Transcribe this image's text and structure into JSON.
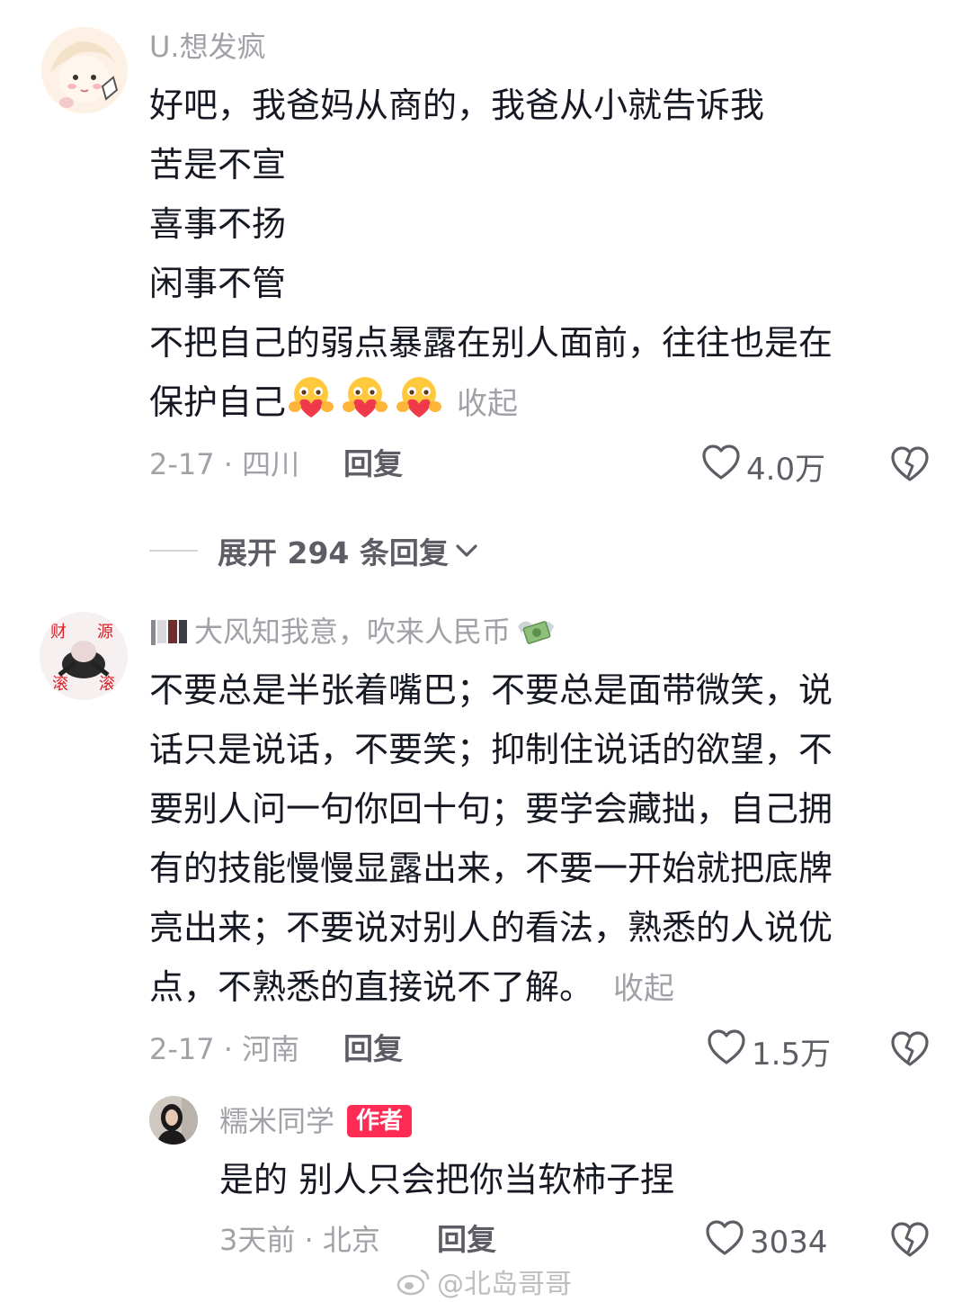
{
  "comments": [
    {
      "username": "U.想发疯",
      "lines": [
        "好吧，我爸妈从商的，我爸从小就告诉我",
        "苦是不宣",
        "喜事不扬",
        "闲事不管",
        "不把自己的弱点暴露在别人面前，往往也是在",
        "保护自己"
      ],
      "emoji": "heart-hug-emoji",
      "collapse": "收起",
      "date_location": "2-17 · 四川",
      "reply": "回复",
      "likes": "4.0万",
      "expand_replies": "展开 294 条回复"
    },
    {
      "username_prefix_icon": "flag-icon",
      "username": "大风知我意，吹来人民币",
      "username_suffix_icon": "money-wings-icon",
      "lines": [
        "不要总是半张着嘴巴；不要总是面带微笑，说",
        "话只是说话，不要笑；抑制住说话的欲望，不",
        "要别人问一句你回十句；要学会藏拙，自己拥",
        "有的技能慢慢显露出来，不要一开始就把底牌",
        "亮出来；不要说对别人的看法，熟悉的人说优",
        "点，不熟悉的直接说不了解。"
      ],
      "collapse": "收起",
      "date_location": "2-17 · 河南",
      "reply": "回复",
      "likes": "1.5万",
      "avatar_text": [
        "财",
        "源",
        "滚",
        "滚"
      ]
    }
  ],
  "reply": {
    "username": "糯米同学",
    "badge": "作者",
    "text": "是的 别人只会把你当软柿子捏",
    "date_location": "3天前 · 北京",
    "reply": "回复",
    "likes": "3034"
  },
  "watermark": "@北岛哥哥",
  "colors": {
    "accent": "#fe2c55",
    "muted": "#a1a2a7",
    "text": "#161823"
  }
}
